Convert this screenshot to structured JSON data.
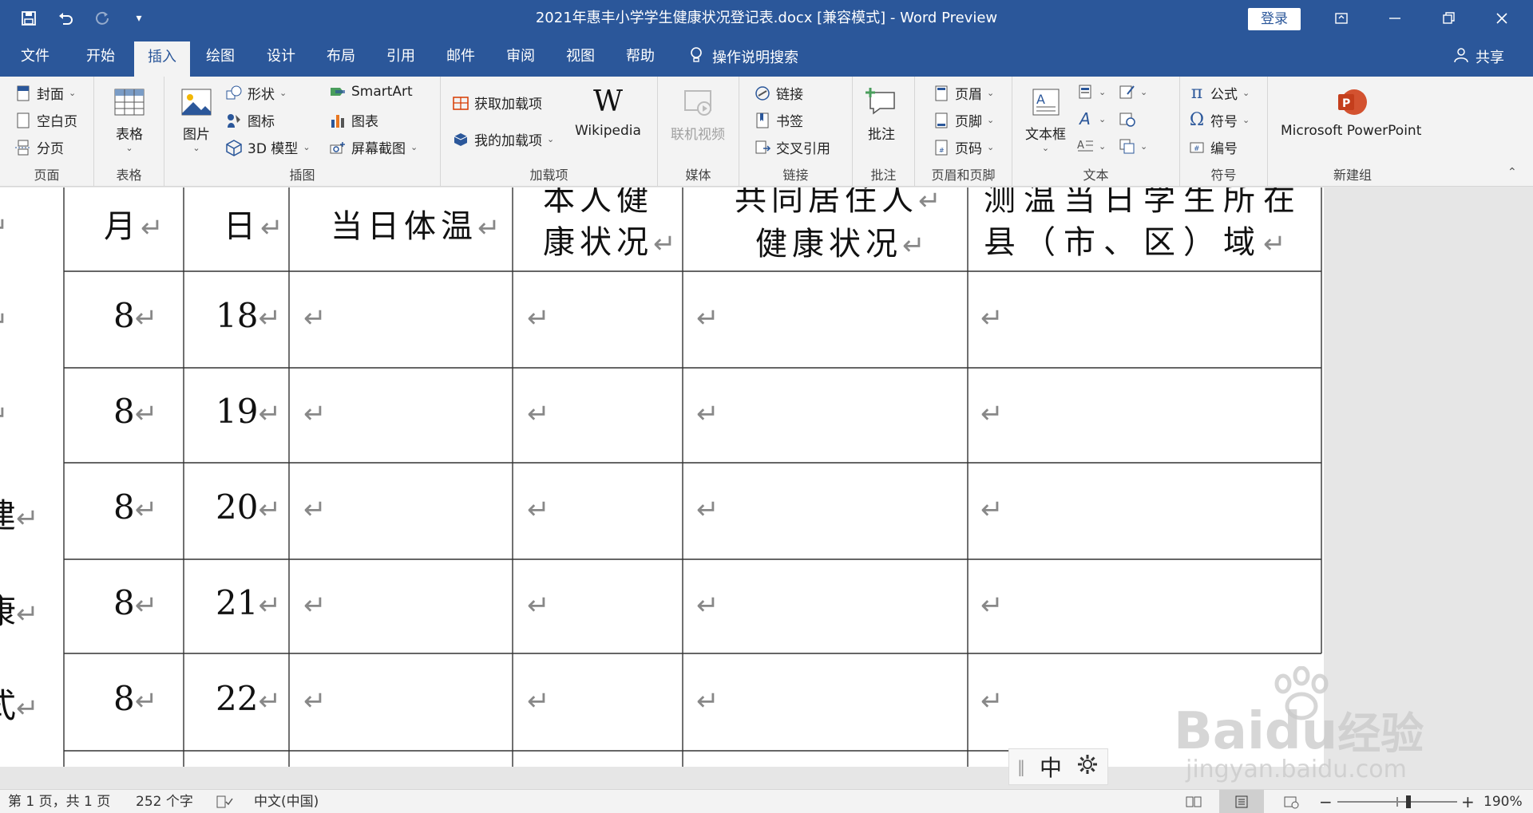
{
  "window": {
    "title": "2021年惠丰小学学生健康状况登记表.docx [兼容模式]  -  Word Preview",
    "login_label": "登录"
  },
  "tabs": [
    "文件",
    "开始",
    "插入",
    "绘图",
    "设计",
    "布局",
    "引用",
    "邮件",
    "审阅",
    "视图",
    "帮助"
  ],
  "active_tab": "插入",
  "tell_me": "操作说明搜索",
  "share": "共享",
  "ribbon": {
    "pages": {
      "label": "页面",
      "cover": "封面",
      "blank": "空白页",
      "break": "分页"
    },
    "table": {
      "label": "表格",
      "table": "表格"
    },
    "illustrations": {
      "label": "插图",
      "picture": "图片",
      "shapes": "形状",
      "icons": "图标",
      "model3d": "3D 模型",
      "smartart": "SmartArt",
      "chart": "图表",
      "screenshot": "屏幕截图"
    },
    "addins": {
      "label": "加载项",
      "get": "获取加载项",
      "my": "我的加载项",
      "wikipedia": "Wikipedia"
    },
    "media": {
      "label": "媒体",
      "video": "联机视频"
    },
    "links": {
      "label": "链接",
      "link": "链接",
      "bookmark": "书签",
      "crossref": "交叉引用"
    },
    "comments": {
      "label": "批注",
      "comment": "批注"
    },
    "headerfooter": {
      "label": "页眉和页脚",
      "header": "页眉",
      "footer": "页脚",
      "pagenum": "页码"
    },
    "text": {
      "label": "文本",
      "textbox": "文本框"
    },
    "symbols": {
      "label": "符号",
      "equation": "公式",
      "symbol": "符号",
      "number": "编号"
    },
    "newgroup": {
      "label": "新建组",
      "ppt": "Microsoft PowerPoint"
    }
  },
  "table": {
    "pilcrow": "↵",
    "header": {
      "month": "月",
      "day": "日",
      "temp": "当日体温",
      "self_1": "本人健",
      "self_2": "康状况",
      "co_1": "共同居住人",
      "co_2": "健康状况",
      "loc_1": "测温当日学生所在",
      "loc_2": "县（市、区）域"
    },
    "left_fragments": [
      "",
      "",
      "",
      "建",
      "康",
      "式"
    ],
    "rows": [
      {
        "month": "8",
        "day": "18"
      },
      {
        "month": "8",
        "day": "19"
      },
      {
        "month": "8",
        "day": "20"
      },
      {
        "month": "8",
        "day": "21"
      },
      {
        "month": "8",
        "day": "22"
      }
    ]
  },
  "ime": {
    "mode": "中"
  },
  "status": {
    "page": "第 1 页，共 1 页",
    "words": "252 个字",
    "lang": "中文(中国)",
    "zoom": "190%"
  },
  "watermark": {
    "brand": "Bai",
    "brand2": "du",
    "cn": "经验",
    "url": "jingyan.baidu.com"
  }
}
